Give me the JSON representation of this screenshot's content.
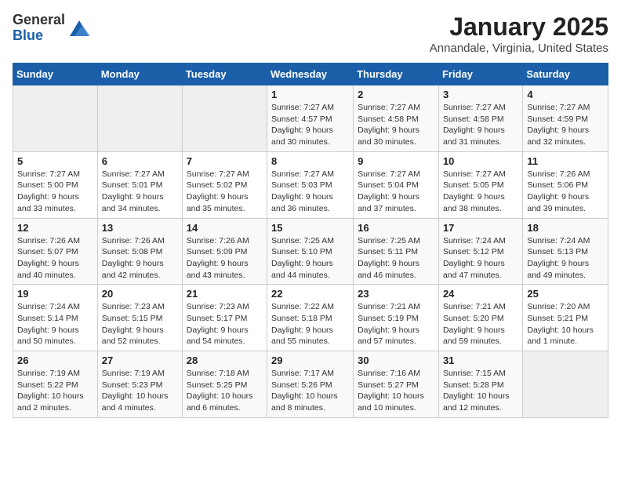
{
  "header": {
    "logo_general": "General",
    "logo_blue": "Blue",
    "title": "January 2025",
    "location": "Annandale, Virginia, United States"
  },
  "weekdays": [
    "Sunday",
    "Monday",
    "Tuesday",
    "Wednesday",
    "Thursday",
    "Friday",
    "Saturday"
  ],
  "weeks": [
    [
      {
        "day": "",
        "info": ""
      },
      {
        "day": "",
        "info": ""
      },
      {
        "day": "",
        "info": ""
      },
      {
        "day": "1",
        "info": "Sunrise: 7:27 AM\nSunset: 4:57 PM\nDaylight: 9 hours\nand 30 minutes."
      },
      {
        "day": "2",
        "info": "Sunrise: 7:27 AM\nSunset: 4:58 PM\nDaylight: 9 hours\nand 30 minutes."
      },
      {
        "day": "3",
        "info": "Sunrise: 7:27 AM\nSunset: 4:58 PM\nDaylight: 9 hours\nand 31 minutes."
      },
      {
        "day": "4",
        "info": "Sunrise: 7:27 AM\nSunset: 4:59 PM\nDaylight: 9 hours\nand 32 minutes."
      }
    ],
    [
      {
        "day": "5",
        "info": "Sunrise: 7:27 AM\nSunset: 5:00 PM\nDaylight: 9 hours\nand 33 minutes."
      },
      {
        "day": "6",
        "info": "Sunrise: 7:27 AM\nSunset: 5:01 PM\nDaylight: 9 hours\nand 34 minutes."
      },
      {
        "day": "7",
        "info": "Sunrise: 7:27 AM\nSunset: 5:02 PM\nDaylight: 9 hours\nand 35 minutes."
      },
      {
        "day": "8",
        "info": "Sunrise: 7:27 AM\nSunset: 5:03 PM\nDaylight: 9 hours\nand 36 minutes."
      },
      {
        "day": "9",
        "info": "Sunrise: 7:27 AM\nSunset: 5:04 PM\nDaylight: 9 hours\nand 37 minutes."
      },
      {
        "day": "10",
        "info": "Sunrise: 7:27 AM\nSunset: 5:05 PM\nDaylight: 9 hours\nand 38 minutes."
      },
      {
        "day": "11",
        "info": "Sunrise: 7:26 AM\nSunset: 5:06 PM\nDaylight: 9 hours\nand 39 minutes."
      }
    ],
    [
      {
        "day": "12",
        "info": "Sunrise: 7:26 AM\nSunset: 5:07 PM\nDaylight: 9 hours\nand 40 minutes."
      },
      {
        "day": "13",
        "info": "Sunrise: 7:26 AM\nSunset: 5:08 PM\nDaylight: 9 hours\nand 42 minutes."
      },
      {
        "day": "14",
        "info": "Sunrise: 7:26 AM\nSunset: 5:09 PM\nDaylight: 9 hours\nand 43 minutes."
      },
      {
        "day": "15",
        "info": "Sunrise: 7:25 AM\nSunset: 5:10 PM\nDaylight: 9 hours\nand 44 minutes."
      },
      {
        "day": "16",
        "info": "Sunrise: 7:25 AM\nSunset: 5:11 PM\nDaylight: 9 hours\nand 46 minutes."
      },
      {
        "day": "17",
        "info": "Sunrise: 7:24 AM\nSunset: 5:12 PM\nDaylight: 9 hours\nand 47 minutes."
      },
      {
        "day": "18",
        "info": "Sunrise: 7:24 AM\nSunset: 5:13 PM\nDaylight: 9 hours\nand 49 minutes."
      }
    ],
    [
      {
        "day": "19",
        "info": "Sunrise: 7:24 AM\nSunset: 5:14 PM\nDaylight: 9 hours\nand 50 minutes."
      },
      {
        "day": "20",
        "info": "Sunrise: 7:23 AM\nSunset: 5:15 PM\nDaylight: 9 hours\nand 52 minutes."
      },
      {
        "day": "21",
        "info": "Sunrise: 7:23 AM\nSunset: 5:17 PM\nDaylight: 9 hours\nand 54 minutes."
      },
      {
        "day": "22",
        "info": "Sunrise: 7:22 AM\nSunset: 5:18 PM\nDaylight: 9 hours\nand 55 minutes."
      },
      {
        "day": "23",
        "info": "Sunrise: 7:21 AM\nSunset: 5:19 PM\nDaylight: 9 hours\nand 57 minutes."
      },
      {
        "day": "24",
        "info": "Sunrise: 7:21 AM\nSunset: 5:20 PM\nDaylight: 9 hours\nand 59 minutes."
      },
      {
        "day": "25",
        "info": "Sunrise: 7:20 AM\nSunset: 5:21 PM\nDaylight: 10 hours\nand 1 minute."
      }
    ],
    [
      {
        "day": "26",
        "info": "Sunrise: 7:19 AM\nSunset: 5:22 PM\nDaylight: 10 hours\nand 2 minutes."
      },
      {
        "day": "27",
        "info": "Sunrise: 7:19 AM\nSunset: 5:23 PM\nDaylight: 10 hours\nand 4 minutes."
      },
      {
        "day": "28",
        "info": "Sunrise: 7:18 AM\nSunset: 5:25 PM\nDaylight: 10 hours\nand 6 minutes."
      },
      {
        "day": "29",
        "info": "Sunrise: 7:17 AM\nSunset: 5:26 PM\nDaylight: 10 hours\nand 8 minutes."
      },
      {
        "day": "30",
        "info": "Sunrise: 7:16 AM\nSunset: 5:27 PM\nDaylight: 10 hours\nand 10 minutes."
      },
      {
        "day": "31",
        "info": "Sunrise: 7:15 AM\nSunset: 5:28 PM\nDaylight: 10 hours\nand 12 minutes."
      },
      {
        "day": "",
        "info": ""
      }
    ]
  ]
}
